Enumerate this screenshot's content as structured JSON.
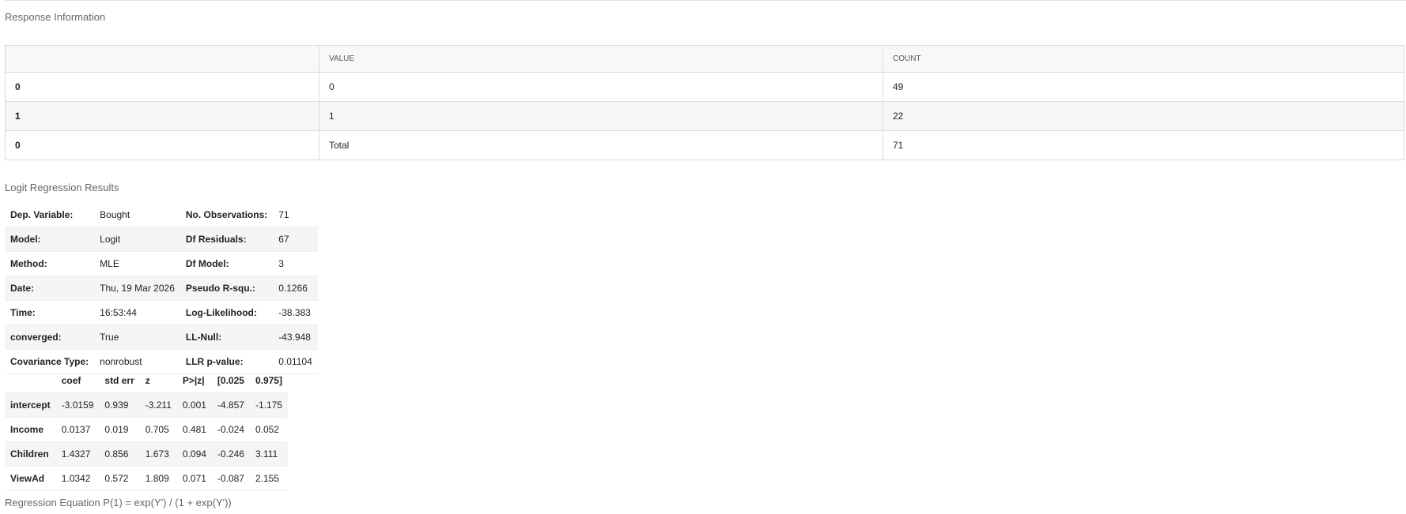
{
  "response_section": {
    "title": "Response Information",
    "columns": [
      "",
      "VALUE",
      "COUNT"
    ],
    "rows": [
      {
        "index": "0",
        "value": "0",
        "count": "49"
      },
      {
        "index": "1",
        "value": "1",
        "count": "22"
      },
      {
        "index": "0",
        "value": "Total",
        "count": "71"
      }
    ]
  },
  "logit_section": {
    "title": "Logit Regression Results",
    "summary": [
      {
        "l1": "Dep. Variable:",
        "v1": "Bought",
        "l2": "No. Observations:",
        "v2": "71"
      },
      {
        "l1": "Model:",
        "v1": "Logit",
        "l2": "Df Residuals:",
        "v2": "67"
      },
      {
        "l1": "Method:",
        "v1": "MLE",
        "l2": "Df Model:",
        "v2": "3"
      },
      {
        "l1": "Date:",
        "v1": "Thu, 19 Mar 2026",
        "l2": "Pseudo R-squ.:",
        "v2": "0.1266"
      },
      {
        "l1": "Time:",
        "v1": "16:53:44",
        "l2": "Log-Likelihood:",
        "v2": "-38.383"
      },
      {
        "l1": "converged:",
        "v1": "True",
        "l2": "LL-Null:",
        "v2": "-43.948"
      },
      {
        "l1": "Covariance Type:",
        "v1": "nonrobust",
        "l2": "LLR p-value:",
        "v2": "0.01104"
      }
    ],
    "coef_headers": [
      "",
      "coef",
      "std err",
      "z",
      "P>|z|",
      "[0.025",
      "0.975]"
    ],
    "coef_rows": [
      {
        "name": "intercept",
        "coef": "-3.0159",
        "se": "0.939",
        "z": "-3.211",
        "p": "0.001",
        "lo": "-4.857",
        "hi": "-1.175"
      },
      {
        "name": "Income",
        "coef": "0.0137",
        "se": "0.019",
        "z": "0.705",
        "p": "0.481",
        "lo": "-0.024",
        "hi": "0.052"
      },
      {
        "name": "Children",
        "coef": "1.4327",
        "se": "0.856",
        "z": "1.673",
        "p": "0.094",
        "lo": "-0.246",
        "hi": "3.111"
      },
      {
        "name": "ViewAd",
        "coef": "1.0342",
        "se": "0.572",
        "z": "1.809",
        "p": "0.071",
        "lo": "-0.087",
        "hi": "2.155"
      }
    ]
  },
  "equation": "Regression Equation P(1) = exp(Y') / (1 + exp(Y'))"
}
